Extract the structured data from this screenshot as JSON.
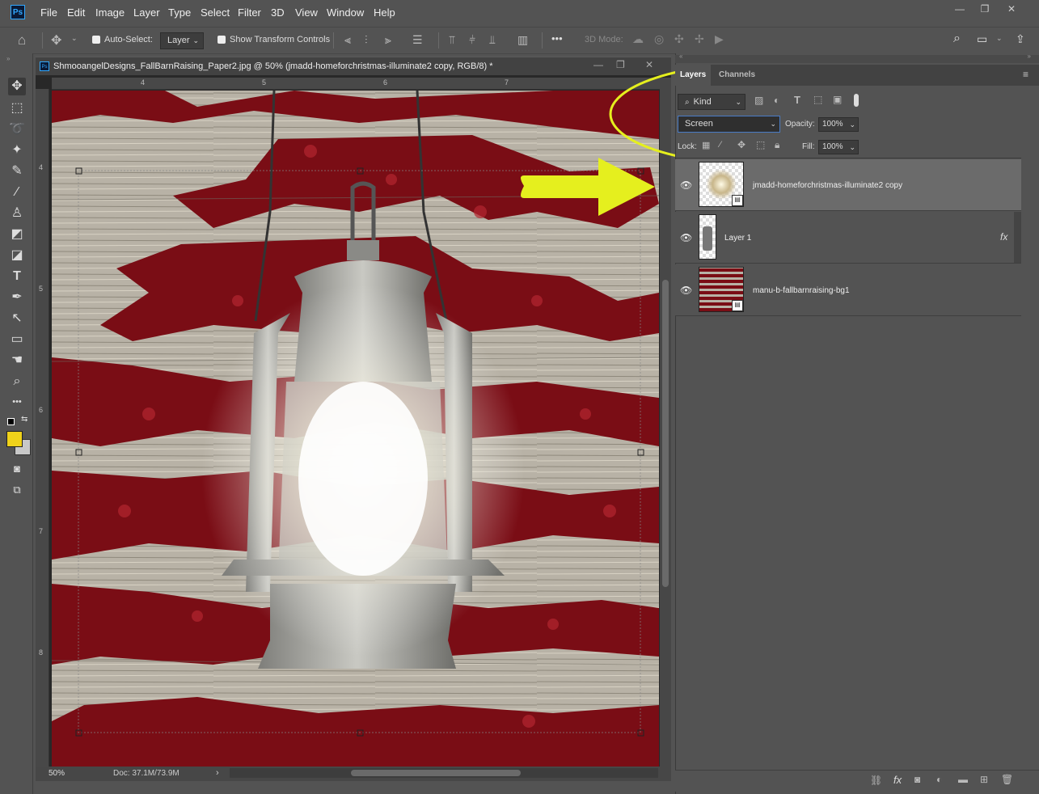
{
  "menu": [
    "File",
    "Edit",
    "Image",
    "Layer",
    "Type",
    "Select",
    "Filter",
    "3D",
    "View",
    "Window",
    "Help"
  ],
  "app_logo": "Ps",
  "options": {
    "auto_select_label": "Auto-Select:",
    "auto_select_value": "Layer",
    "show_transform_label": "Show Transform Controls",
    "mode_3d_label": "3D Mode:"
  },
  "document": {
    "tab_title": "ShmooangelDesigns_FallBarnRaising_Paper2.jpg @ 50% (jmadd-homeforchristmas-illuminate2 copy, RGB/8) *",
    "zoom": "50%",
    "doc_size": "Doc: 37.1M/73.9M",
    "ruler_h": [
      "4",
      "5",
      "6",
      "7"
    ],
    "ruler_v": [
      "4",
      "5",
      "6",
      "7",
      "8"
    ]
  },
  "panel": {
    "tabs": [
      "Layers",
      "Channels"
    ],
    "kind_label": "Kind",
    "blend_mode": "Screen",
    "opacity_label": "Opacity:",
    "opacity_value": "100%",
    "lock_label": "Lock:",
    "fill_label": "Fill:",
    "fill_value": "100%",
    "layers": [
      {
        "name": "jmadd-homeforchristmas-illuminate2 copy",
        "selected": true
      },
      {
        "name": "Layer 1",
        "fx": "fx"
      },
      {
        "name": "manu-b-fallbarnraising-bg1"
      }
    ]
  },
  "colors": {
    "highlight": "#e5ef1e",
    "foreground": "#f0d21a",
    "background": "#c8c8c8",
    "accent": "#31a8ff",
    "barn_red": "#7a0d15"
  },
  "icons": {
    "move": "✥",
    "marquee": "⬚",
    "lasso": "ʟ",
    "magic_wand": "✦",
    "eyedropper": "✎",
    "brush": "🖌",
    "stamp": "⊥",
    "eraser": "◩",
    "gradient": "◪",
    "type": "T",
    "pen": "✒",
    "select": "↖",
    "rect": "▭",
    "hand": "✋",
    "zoom": "⌕",
    "more": "•••"
  }
}
